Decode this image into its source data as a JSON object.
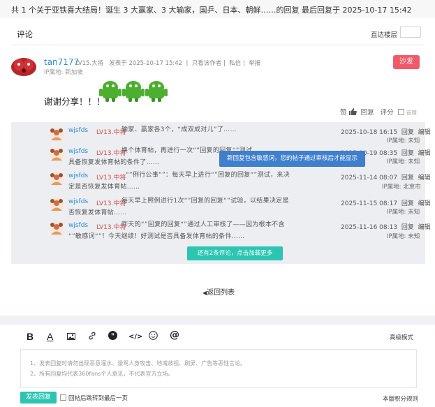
{
  "header": {
    "thread_title": "共 1 个关于亚铁喜大结局！诞生 3 大赢家、3 大输家，国乒、日本、朝鲜……的回复 最后回复于 2025-10-17 15:42"
  },
  "section": {
    "title": "评论",
    "jump_label": "直达楼层",
    "jump_placeholder": ""
  },
  "post": {
    "username": "tan7177",
    "level": "LV15.大将",
    "posted_at": "发表于 2025-10-17 15:42",
    "only_author": "只看该作者",
    "message": "私信",
    "report": "举报",
    "ip": "IP属地: 新加坡",
    "red_button": "沙发",
    "content": "谢谢分享！！！",
    "like_label": "赞",
    "reply_label": "回复",
    "rate_label": "评分",
    "checkbox_label": "管理"
  },
  "replies": [
    {
      "name": "wjsfds",
      "level": "LV13.中将",
      "text_lines": [
        "输家、赢家各3个，“成双成对儿”了……"
      ],
      "time": "2025-10-18 16:15",
      "reply": "回复",
      "edit": "编辑",
      "ip": "IP属地: 未知"
    },
    {
      "name": "wjsfds",
      "level": "LV13.中将",
      "text_lines": [
        "换个体育帖，再进行一次“”回复的回复“”测试，",
        "具备恢复发体育帖的条件了……"
      ],
      "time": "2025-10-19 08:35",
      "reply": "回复",
      "edit": "编辑",
      "ip": "IP属地: 未知"
    },
    {
      "name": "wjsfds",
      "level": "LV13.中将",
      "text_lines": [
        "“”例行公事“”：每天早上进行“”回复的回复“”测试，来决",
        "定是否恢复发体育帖……"
      ],
      "time": "2025-11-14 08:07",
      "reply": "回复",
      "edit": "编辑",
      "ip": "IP属地: 北京市"
    },
    {
      "name": "wjsfds",
      "level": "LV13.中将",
      "text_lines": [
        "每天早上照例进行1次“”回复的回复“”试验，以结果决定是",
        "否恢复发体育帖……"
      ],
      "time": "2025-11-15 08:17",
      "reply": "回复",
      "edit": "编辑",
      "ip": "IP属地: 未知"
    },
    {
      "name": "wjsfds",
      "level": "LV13.中将",
      "text_lines": [
        "昨天的“”回复的回复“”通过人工审核了——因为根本不含",
        "“”敏感词“”！今天继续！好测试是否具备发体育帖的条件……"
      ],
      "time": "2025-11-16 08:13",
      "reply": "回复",
      "edit": "编辑",
      "ip": "IP属地: 未知"
    }
  ],
  "toast": "新回复包含敏感词，您的帖子通过审核后才能显示",
  "more_comments": "还有2条评论，点击加载更多",
  "back_to_list": "返回列表",
  "editor": {
    "advanced_mode": "高级模式",
    "hint_line1": "1、发表回复时请勿出现恶意灌水、谩骂人身攻击、地域歧视、刷屏、广告等恶性言论。",
    "hint_line2": "2、所有回复均代表360fans个人意见，不代表官方立场。",
    "send_button": "发表回复",
    "jump_checkbox": "回帖后跳转到最后一页",
    "rules_link": "本版积分规则"
  },
  "colors": {
    "accent": "#2cc5b2",
    "link": "#2a8bd0",
    "danger": "#f0596a",
    "toast": "#3f7fce"
  }
}
